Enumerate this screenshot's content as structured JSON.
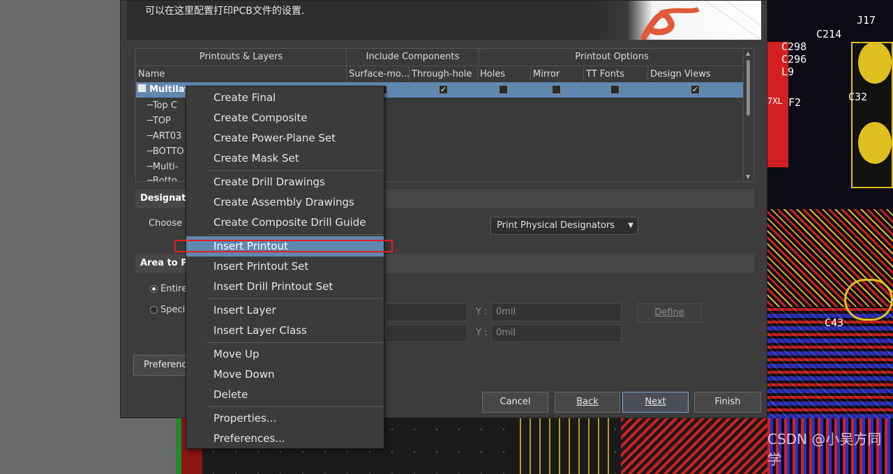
{
  "header": {
    "description": "可以在这里配置打印PCB文件的设置."
  },
  "grid": {
    "group_headers": [
      "Printouts & Layers",
      "Include Components",
      "Printout Options"
    ],
    "columns": [
      "Name",
      "Surface-mo...",
      "Through-hole",
      "Holes",
      "Mirror",
      "TT Fonts",
      "Design Views"
    ],
    "root_item": "Multilay",
    "root_checks": {
      "through_hole": true,
      "holes": false,
      "mirror": false,
      "tt_fonts": false,
      "design_views": true
    },
    "children": [
      "Top C",
      "TOP",
      "ART03",
      "BOTTO",
      "Multi-",
      "Botto"
    ]
  },
  "designators": {
    "section_title": "Designato",
    "choose_label": "Choose t",
    "dropdown_value": "Print Physical Designators"
  },
  "area": {
    "section_title": "Area to Pr",
    "entire_label": "Entire",
    "specific_label": "Specifi",
    "y_label_1": "Y :",
    "y_value_1": "0mil",
    "y_label_2": "Y :",
    "y_value_2": "0mil",
    "define_label": "Define"
  },
  "footer": {
    "preferences_label": "Preference",
    "cancel_label": "Cancel",
    "back_label": "Back",
    "next_label": "Next",
    "finish_label": "Finish"
  },
  "context_menu": {
    "items": [
      "Create Final",
      "Create Composite",
      "Create Power-Plane Set",
      "Create Mask Set",
      "Create Drill Drawings",
      "Create Assembly Drawings",
      "Create Composite Drill Guide",
      "Insert Printout",
      "Insert Printout Set",
      "Insert Drill Printout Set",
      "Insert Layer",
      "Insert Layer Class",
      "Move Up",
      "Move Down",
      "Delete",
      "Properties...",
      "Preferences..."
    ],
    "highlighted": "Insert Printout"
  },
  "pcb": {
    "labels": [
      "J17",
      "C214",
      "C298",
      "C296",
      "L9",
      "7XL",
      "F2",
      "C32",
      "C43"
    ]
  },
  "watermark": "CSDN @小吴方同学",
  "colors": {
    "dialog_bg": "#3c3c3c",
    "selection": "#5f87b0",
    "highlight_box": "#e02020",
    "pcb_red": "#d21f1f",
    "pcb_yellow": "#e0c020",
    "pcb_blue": "#2030d0"
  }
}
